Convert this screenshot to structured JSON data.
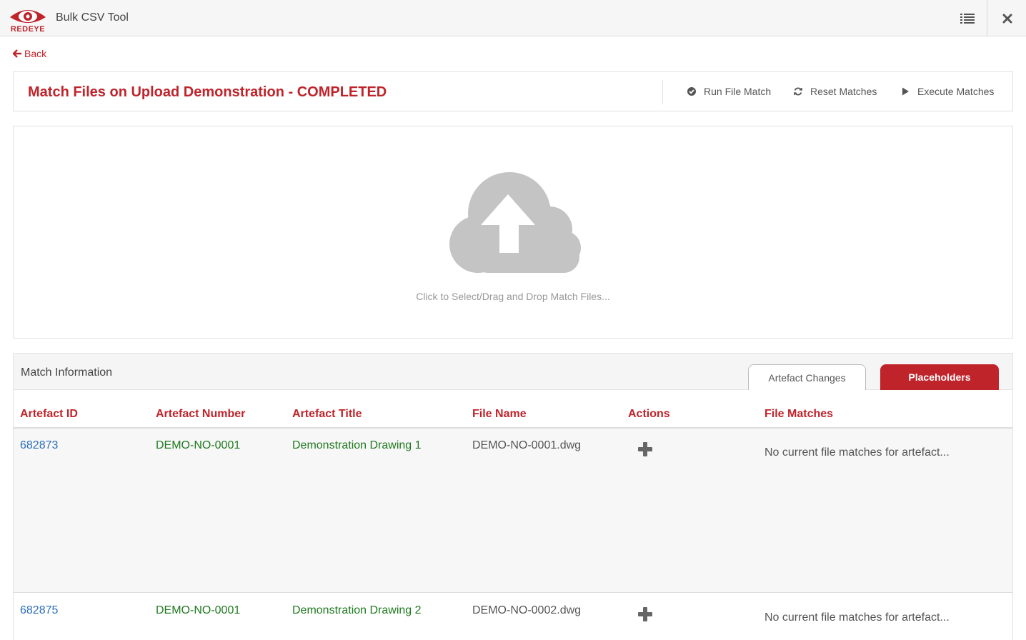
{
  "app": {
    "logo_text": "REDEYE",
    "title": "Bulk CSV Tool"
  },
  "nav": {
    "back_label": "Back"
  },
  "header": {
    "title": "Match Files on Upload Demonstration - COMPLETED",
    "actions": [
      {
        "label": "Run File Match",
        "icon": "check-circle-icon"
      },
      {
        "label": "Reset Matches",
        "icon": "refresh-icon"
      },
      {
        "label": "Execute Matches",
        "icon": "play-icon"
      }
    ]
  },
  "dropzone": {
    "text": "Click to Select/Drag and Drop Match Files...",
    "icon": "cloud-upload-icon"
  },
  "match": {
    "title": "Match Information",
    "tabs": [
      {
        "label": "Artefact Changes",
        "active": false
      },
      {
        "label": "Placeholders",
        "active": true
      }
    ],
    "columns": [
      "Artefact ID",
      "Artefact Number",
      "Artefact Title",
      "File Name",
      "Actions",
      "File Matches"
    ],
    "rows": [
      {
        "id": "682873",
        "number": "DEMO-NO-0001",
        "title": "Demonstration Drawing 1",
        "file": "DEMO-NO-0001.dwg",
        "matches": "No current file matches for artefact..."
      },
      {
        "id": "682875",
        "number": "DEMO-NO-0001",
        "title": "Demonstration Drawing 2",
        "file": "DEMO-NO-0002.dwg",
        "matches": "No current file matches for artefact..."
      }
    ]
  },
  "colors": {
    "brand_red": "#c0242b",
    "link_blue": "#2a6ebb",
    "text_green": "#1f7a1f",
    "cloud_gray": "#c4c4c4"
  }
}
